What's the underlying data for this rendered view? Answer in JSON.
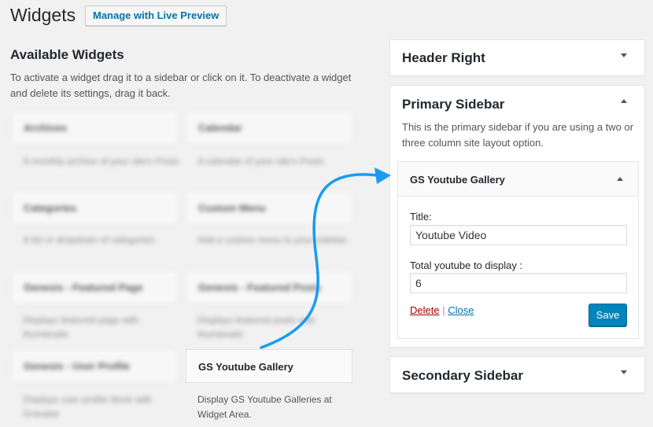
{
  "page": {
    "title": "Widgets",
    "live_preview_label": "Manage with Live Preview"
  },
  "available": {
    "title": "Available Widgets",
    "description": "To activate a widget drag it to a sidebar or click on it. To deactivate a widget and delete its settings, drag it back.",
    "widgets": [
      {
        "name": "Archives",
        "desc": "A monthly archive of your site's Posts."
      },
      {
        "name": "Calendar",
        "desc": "A calendar of your site's Posts."
      },
      {
        "name": "Categories",
        "desc": "A list or dropdown of categories."
      },
      {
        "name": "Custom Menu",
        "desc": "Add a custom menu to your sidebar."
      },
      {
        "name": "Genesis - Featured Page",
        "desc": "Displays featured page with thumbnails"
      },
      {
        "name": "Genesis - Featured Posts",
        "desc": "Displays featured posts with thumbnails"
      },
      {
        "name": "Genesis - User Profile",
        "desc": "Displays user profile block with Gravatar"
      }
    ],
    "gs_widget": {
      "name": "GS Youtube Gallery",
      "desc": "Display GS Youtube Galleries at Widget Area."
    }
  },
  "sidebars": {
    "header_right": {
      "title": "Header Right"
    },
    "primary": {
      "title": "Primary Sidebar",
      "description": "This is the primary sidebar if you are using a two or three column site layout option.",
      "widget": {
        "title": "GS Youtube Gallery",
        "title_label": "Title:",
        "title_value": "Youtube Video",
        "count_label": "Total youtube to display :",
        "count_value": "6",
        "delete_label": "Delete",
        "separator": "|",
        "close_label": "Close",
        "save_label": "Save"
      }
    },
    "secondary": {
      "title": "Secondary Sidebar"
    }
  },
  "colors": {
    "accent": "#0073aa",
    "save_button": "#0085ba",
    "arrow": "#1a9bf0",
    "delete": "#aa0000"
  }
}
